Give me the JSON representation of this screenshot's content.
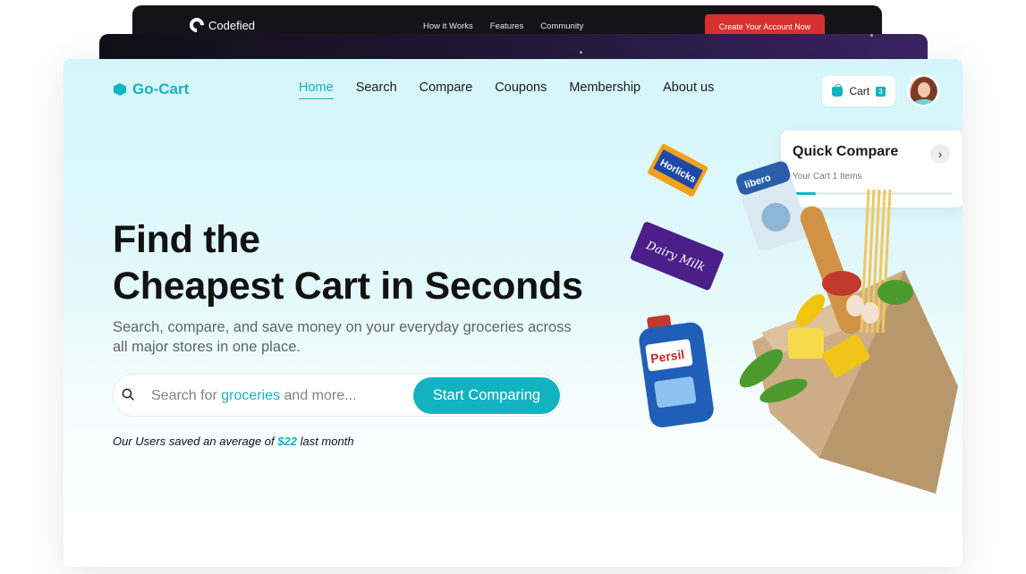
{
  "back_window_1": {
    "brand": "Codefied",
    "nav": [
      "How it Works",
      "Features",
      "Community"
    ],
    "cta": "Create Your Account Now"
  },
  "header": {
    "brand": "Go-Cart",
    "nav": [
      "Home",
      "Search",
      "Compare",
      "Coupons",
      "Membership",
      "About us"
    ],
    "active_nav": "Home",
    "cart_label": "Cart",
    "cart_count": "3"
  },
  "quick_compare": {
    "title": "Quick Compare",
    "subtitle": "Your Cart 1 Items",
    "progress": 0.15
  },
  "hero": {
    "title_line1": "Find the",
    "title_line2": "Cheapest Cart in Seconds",
    "subtitle": "Search, compare, and save money on your everyday groceries across all major stores in one place."
  },
  "search": {
    "placeholder_prefix": "Search for ",
    "placeholder_highlight": "groceries",
    "placeholder_suffix": " and more...",
    "button_label": "Start Comparing"
  },
  "savings": {
    "prefix": "Our Users saved an average of ",
    "amount": "$22",
    "suffix": " last month"
  },
  "products": {
    "persil": "Persil",
    "dairy_milk": "Dairy Milk",
    "horlicks": "Horlicks",
    "libero": "libero"
  },
  "colors": {
    "accent": "#12b3c1",
    "cta_red": "#d6312f",
    "text_dark": "#121212"
  }
}
